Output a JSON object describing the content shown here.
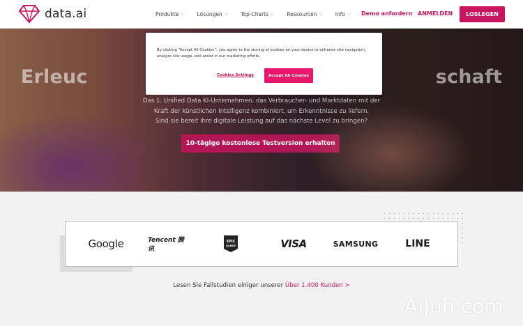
{
  "brand": {
    "name": "data.ai",
    "accent": "#c8155f"
  },
  "nav": {
    "menu": [
      {
        "label": "Produkte"
      },
      {
        "label": "Lösungen"
      },
      {
        "label": "Top-Charts"
      },
      {
        "label": "Ressourcen"
      },
      {
        "label": "Info"
      }
    ],
    "demo_label": "Demo anfordern",
    "login_label": "ANMELDEN",
    "cta_label": "LOSLEGEN"
  },
  "hero": {
    "title": "Erleuc                                                    schaft",
    "subtitle_lines": [
      "Das 1. Unified Data KI-Unternehmen, das Verbraucher- und Marktdaten mit der",
      "Kraft der künstlichen Intelligenz kombiniert, um Erkenntnisse zu liefern.",
      "Sind sie bereit ihre digitale Leistung auf das nächste Level zu bringen?"
    ],
    "cta_label": "10-tägige kostenlose Testversion erhalten"
  },
  "cookie": {
    "text": "By clicking “Accept All Cookies”, you agree to the storing of cookies on your device to enhance site navigation, analyze site usage, and assist in our marketing efforts.",
    "settings_label": "Cookies Settings",
    "accept_label": "Accept All Cookies"
  },
  "logos": {
    "google": "Google",
    "tencent": "Tencent 腾讯",
    "epic_top": "EPIC",
    "epic_bottom": "GAMES",
    "visa": "VISA",
    "samsung": "SAMSUNG",
    "line": "LINE"
  },
  "case_studies": {
    "text": "Lesen Sie Fallstudien einiger unserer ",
    "link": "Über 1.400 Kunden >"
  },
  "watermark": "AiJuh.com"
}
